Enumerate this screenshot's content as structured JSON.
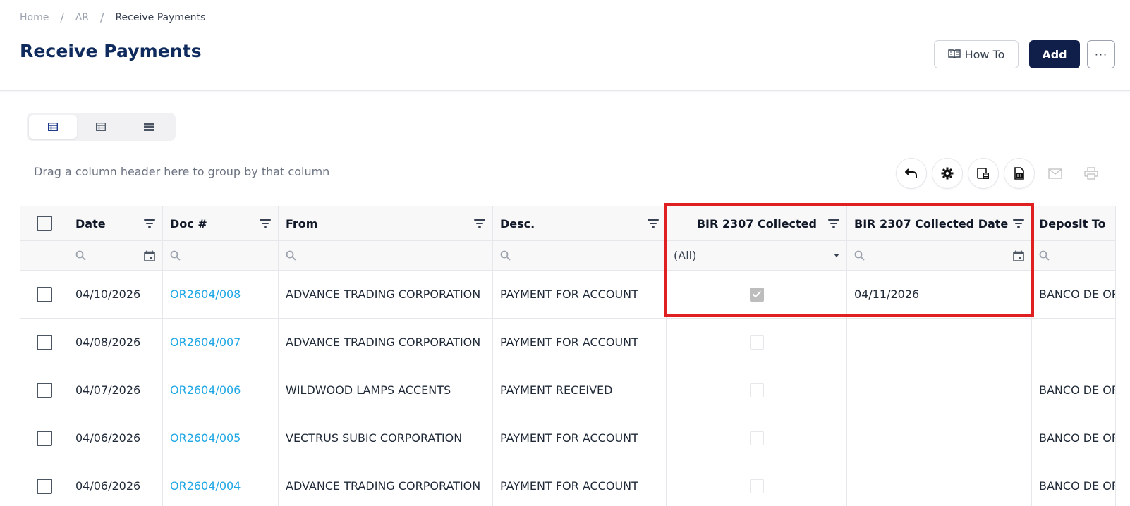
{
  "breadcrumb": {
    "home": "Home",
    "ar": "AR",
    "current": "Receive Payments"
  },
  "page": {
    "title": "Receive Payments"
  },
  "actions": {
    "howto_label": "How To",
    "add_label": "Add",
    "more_label": "···"
  },
  "view_modes": [
    "table-view-icon",
    "list-view-icon",
    "compact-view-icon"
  ],
  "grid": {
    "group_hint": "Drag a column header here to group by that column",
    "columns": [
      "Date",
      "Doc #",
      "From",
      "Desc.",
      "BIR 2307 Collected",
      "BIR 2307 Collected Date",
      "Deposit To"
    ],
    "bir_filter_value": "(All)",
    "rows": [
      {
        "date": "04/10/2026",
        "doc": "OR2604/008",
        "from": "ADVANCE TRADING CORPORATION",
        "desc": "PAYMENT FOR ACCOUNT",
        "bir_collected": true,
        "bir_date": "04/11/2026",
        "deposit": "BANCO DE OR"
      },
      {
        "date": "04/08/2026",
        "doc": "OR2604/007",
        "from": "ADVANCE TRADING CORPORATION",
        "desc": "PAYMENT FOR ACCOUNT",
        "bir_collected": false,
        "bir_date": "",
        "deposit": ""
      },
      {
        "date": "04/07/2026",
        "doc": "OR2604/006",
        "from": "WILDWOOD LAMPS ACCENTS",
        "desc": "PAYMENT RECEIVED",
        "bir_collected": false,
        "bir_date": "",
        "deposit": "BANCO DE OR"
      },
      {
        "date": "04/06/2026",
        "doc": "OR2604/005",
        "from": "VECTRUS SUBIC CORPORATION",
        "desc": "PAYMENT FOR ACCOUNT",
        "bir_collected": false,
        "bir_date": "",
        "deposit": "BANCO DE OR"
      },
      {
        "date": "04/06/2026",
        "doc": "OR2604/004",
        "from": "ADVANCE TRADING CORPORATION",
        "desc": "PAYMENT FOR ACCOUNT",
        "bir_collected": false,
        "bir_date": "",
        "deposit": "BANCO DE OR"
      }
    ]
  },
  "colors": {
    "brand_navy": "#0f2a5c",
    "add_button": "#0f1f4a",
    "link": "#1ea7e4",
    "highlight": "#e02020"
  }
}
